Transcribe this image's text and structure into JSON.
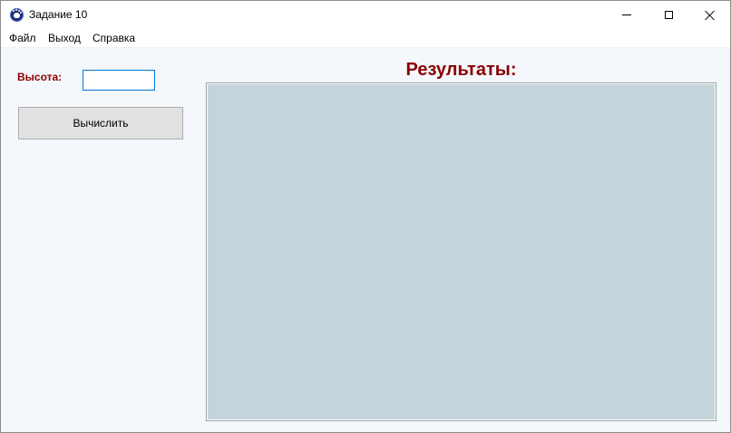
{
  "window": {
    "title": "Задание 10",
    "icon": "paw-icon",
    "controls": {
      "minimize": "minimize-icon",
      "maximize": "maximize-icon",
      "close": "close-icon"
    }
  },
  "menu": {
    "items": [
      "Файл",
      "Выход",
      "Справка"
    ]
  },
  "form": {
    "height_label": "Высота:",
    "height_value": "",
    "calculate_label": "Вычислить"
  },
  "results": {
    "title": "Результаты:",
    "content": ""
  },
  "colors": {
    "label_color": "#8b0000",
    "client_background": "#f4f7fb",
    "results_background": "#c5d4db",
    "input_focus_border": "#0078d7",
    "button_background": "#e1e1e1"
  }
}
